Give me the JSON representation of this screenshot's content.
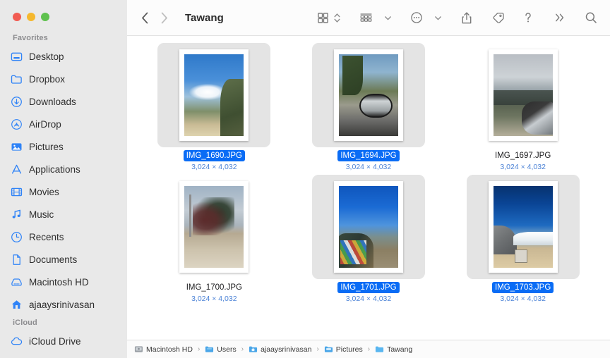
{
  "window": {
    "traffic_lights": [
      {
        "name": "close",
        "color": "#f15b52"
      },
      {
        "name": "minimize",
        "color": "#f5b82e"
      },
      {
        "name": "maximize",
        "color": "#5fc14e"
      }
    ]
  },
  "sidebar": {
    "sections": [
      {
        "title": "Favorites",
        "items": [
          {
            "label": "Desktop",
            "icon": "desktop-icon"
          },
          {
            "label": "Dropbox",
            "icon": "folder-icon"
          },
          {
            "label": "Downloads",
            "icon": "download-icon"
          },
          {
            "label": "AirDrop",
            "icon": "airdrop-icon"
          },
          {
            "label": "Pictures",
            "icon": "pictures-icon"
          },
          {
            "label": "Applications",
            "icon": "applications-icon"
          },
          {
            "label": "Movies",
            "icon": "movies-icon"
          },
          {
            "label": "Music",
            "icon": "music-icon"
          },
          {
            "label": "Recents",
            "icon": "clock-icon"
          },
          {
            "label": "Documents",
            "icon": "document-icon"
          },
          {
            "label": "Macintosh HD",
            "icon": "harddisk-icon"
          },
          {
            "label": "ajaaysrinivasan",
            "icon": "home-icon"
          }
        ]
      },
      {
        "title": "iCloud",
        "items": [
          {
            "label": "iCloud Drive",
            "icon": "cloud-icon"
          }
        ]
      }
    ]
  },
  "toolbar": {
    "back_label": "‹",
    "forward_label": "›",
    "title": "Tawang",
    "buttons": [
      {
        "name": "view-grid-button",
        "icon": "grid-view-icon"
      },
      {
        "name": "view-sort-chevron",
        "icon": "chevron-updown-icon"
      },
      {
        "name": "group-by-button",
        "icon": "group-list-icon"
      },
      {
        "name": "group-by-chevron",
        "icon": "chevron-down-icon"
      },
      {
        "name": "more-actions-button",
        "icon": "ellipsis-circle-icon"
      },
      {
        "name": "more-actions-chevron",
        "icon": "chevron-down-icon"
      },
      {
        "name": "share-button",
        "icon": "share-icon"
      },
      {
        "name": "tag-button",
        "icon": "tag-icon"
      },
      {
        "name": "help-button",
        "icon": "question-mark-icon"
      },
      {
        "name": "overflow-button",
        "icon": "double-chevron-right-icon"
      },
      {
        "name": "search-button",
        "icon": "search-icon"
      }
    ]
  },
  "files": [
    {
      "name": "IMG_1690.JPG",
      "dimensions": "3,024 × 4,032",
      "selected": true,
      "art": "p1690"
    },
    {
      "name": "IMG_1694.JPG",
      "dimensions": "3,024 × 4,032",
      "selected": true,
      "art": "p1694"
    },
    {
      "name": "IMG_1697.JPG",
      "dimensions": "3,024 × 4,032",
      "selected": false,
      "art": "p1697"
    },
    {
      "name": "IMG_1700.JPG",
      "dimensions": "3,024 × 4,032",
      "selected": false,
      "art": "p1700"
    },
    {
      "name": "IMG_1701.JPG",
      "dimensions": "3,024 × 4,032",
      "selected": true,
      "art": "p1701"
    },
    {
      "name": "IMG_1703.JPG",
      "dimensions": "3,024 × 4,032",
      "selected": true,
      "art": "p1703"
    }
  ],
  "pathbar": {
    "separator": "›",
    "crumbs": [
      {
        "label": "Macintosh HD",
        "icon": "harddisk-icon"
      },
      {
        "label": "Users",
        "icon": "folder-icon"
      },
      {
        "label": "ajaaysrinivasan",
        "icon": "home-folder-icon"
      },
      {
        "label": "Pictures",
        "icon": "folder-icon"
      },
      {
        "label": "Tawang",
        "icon": "folder-icon"
      }
    ]
  },
  "colors": {
    "selection_blue": "#0a6cf5",
    "sidebar_icon_blue": "#2f83f7",
    "dimension_text_blue": "#4b82d6",
    "sidebar_bg": "#e9e9e9",
    "selected_tile_bg": "#e4e4e4"
  }
}
